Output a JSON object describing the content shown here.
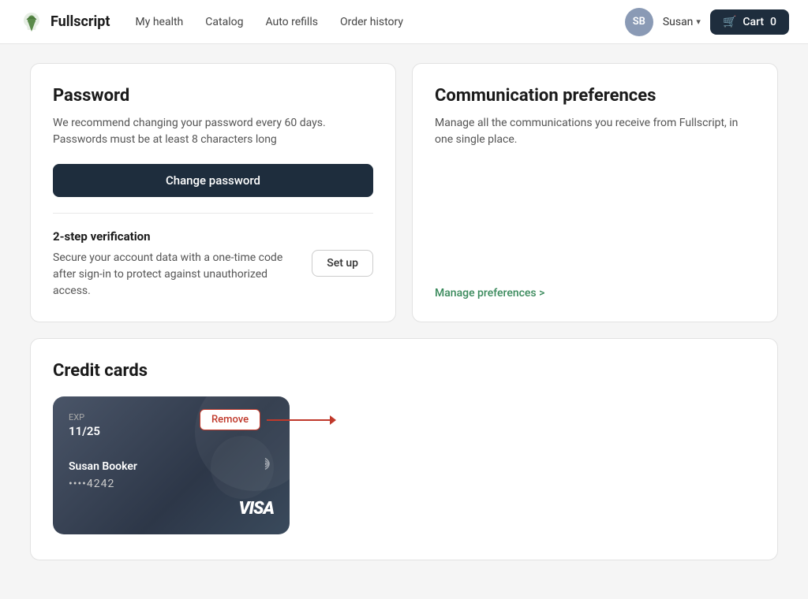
{
  "nav": {
    "brand": "Fullscript",
    "links": [
      {
        "label": "My health",
        "id": "my-health"
      },
      {
        "label": "Catalog",
        "id": "catalog"
      },
      {
        "label": "Auto refills",
        "id": "auto-refills"
      },
      {
        "label": "Order history",
        "id": "order-history"
      }
    ],
    "avatar_initials": "SB",
    "user_name": "Susan",
    "cart_label": "Cart",
    "cart_count": "0"
  },
  "password_card": {
    "title": "Password",
    "description": "We recommend changing your password every 60 days. Passwords must be at least 8 characters long",
    "change_btn": "Change password",
    "verification_title": "2-step verification",
    "verification_desc": "Secure your account data with a one-time code after sign-in to protect against unauthorized access.",
    "setup_btn": "Set up"
  },
  "communication_card": {
    "title": "Communication preferences",
    "description": "Manage all the communications you receive from Fullscript, in one single place.",
    "manage_link": "Manage preferences >"
  },
  "credit_cards": {
    "title": "Credit cards",
    "card": {
      "exp_label": "EXP",
      "exp_value": "11/25",
      "name": "Susan Booker",
      "number": "••••4242",
      "brand": "VISA"
    },
    "remove_btn": "Remove"
  }
}
